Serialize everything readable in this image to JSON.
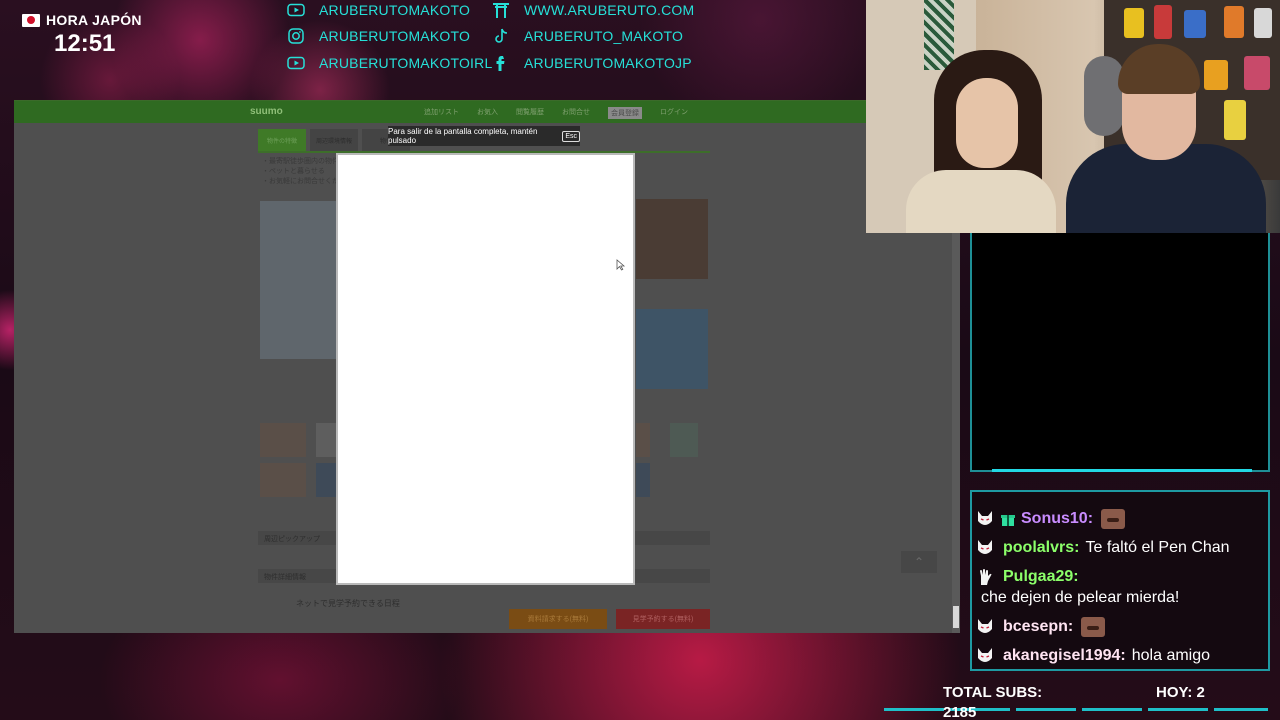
{
  "clock": {
    "label": "HORA JAPÓN",
    "time": "12:51"
  },
  "socials": [
    {
      "icon": "youtube-icon",
      "text": "ARUBERUTOMAKOTO"
    },
    {
      "icon": "instagram-icon",
      "text": "ARUBERUTOMAKOTO"
    },
    {
      "icon": "youtube-icon",
      "text": "ARUBERUTOMAKOTOIRL"
    },
    {
      "icon": "torii-icon",
      "text": "WWW.ARUBERUTO.COM"
    },
    {
      "icon": "tiktok-icon",
      "text": "ARUBERUTO_MAKOTO"
    },
    {
      "icon": "facebook-icon",
      "text": "ARUBERUTOMAKOTOJP"
    }
  ],
  "browser": {
    "site_logo": "suumo",
    "nav": [
      "追加リスト",
      "お気入",
      "閲覧履歴",
      "お問合せ",
      "会員登録",
      "ログイン"
    ],
    "tabs": [
      "物件の特徴",
      "周辺環境情報",
      "物件"
    ],
    "bullets": [
      "・最寄駅徒歩圏内の物件",
      "・ペットと暮らせる",
      "・お気軽にお問合せください"
    ],
    "sections": [
      "周辺ピックアップ",
      "物件詳細情報"
    ],
    "reserve_note": "ネットで見学予約できる日程",
    "buttons": {
      "inquiry": "資料請求する(無料)",
      "reserve": "見学予約する(無料)"
    },
    "fullscreen_notice": "Para salir de la pantalla completa, mantén pulsado",
    "esc_key": "Esc"
  },
  "chat": {
    "messages": [
      {
        "user": "Sonus10:",
        "text": "",
        "user_color": "#c98cff",
        "badge": "kitsune-mask-icon",
        "extra_badge": "gift-icon",
        "emote": true
      },
      {
        "user": "poolalvrs:",
        "text": "Te faltó el Pen Chan",
        "user_color": "#8cff6a",
        "badge": "kitsune-mask-icon",
        "emote": false
      },
      {
        "user": "Pulgaa29:",
        "text": "che dejen de pelear mierda!",
        "user_color": "#8cff6a",
        "badge": "hand-icon",
        "emote": false
      },
      {
        "user": "bcesepn:",
        "text": "",
        "user_color": "#ffe4f2",
        "badge": "kitsune-mask-icon",
        "emote": true
      },
      {
        "user": "akanegisel1994:",
        "text": "hola amigo",
        "user_color": "#ffe4f2",
        "badge": "kitsune-mask-icon",
        "emote": false
      }
    ]
  },
  "subs": {
    "label": "TOTAL SUBS:",
    "count": "2185",
    "today": "HOY: 2"
  },
  "colors": {
    "accent": "#26e0d8",
    "panel_border": "#1e9aa2",
    "site_green": "#2f6a21"
  }
}
